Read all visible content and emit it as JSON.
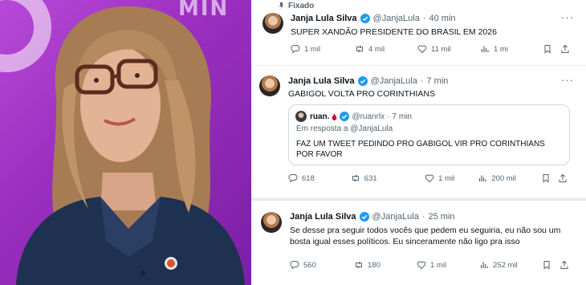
{
  "photo": {
    "background_text": "MIN",
    "accent": "#a63bcf"
  },
  "tweets": [
    {
      "pinned_label": "Fixado",
      "author": "Janja Lula Silva",
      "handle": "@JanjaLula",
      "separator": "·",
      "time": "40 min",
      "text": "SUPER XANDÃO PRESIDENTE DO BRASIL EM 2026",
      "replies": "1 mil",
      "retweets": "4 mil",
      "likes": "11 mil",
      "views": "1 mi"
    },
    {
      "author": "Janja Lula Silva",
      "handle": "@JanjaLula",
      "separator": "·",
      "time": "7 min",
      "text": "GABIGOL VOLTA PRO CORINTHIANS",
      "quote": {
        "author": "ruan.",
        "handle": "@ruanrlx",
        "separator": "·",
        "time": "7 min",
        "reply_prefix": "Em resposta a",
        "reply_mention": "@JanjaLula",
        "text": "FAZ UM TWEET PEDINDO PRO GABIGOL VIR PRO CORINTHIANS POR FAVOR"
      },
      "replies": "618",
      "retweets": "631",
      "likes": "1 mil",
      "views": "200 mil"
    },
    {
      "author": "Janja Lula Silva",
      "handle": "@JanjaLula",
      "separator": "·",
      "time": "25 min",
      "text": "Se desse pra seguir todos vocês que pedem eu seguiria, eu não sou um bosta igual esses políticos. Eu sinceramente não ligo pra isso",
      "replies": "560",
      "retweets": "180",
      "likes": "1 mil",
      "views": "252 mil"
    }
  ],
  "colors": {
    "verified": "#1d9bf0",
    "muted": "#536471",
    "border": "#cfd9de",
    "text": "#0f1419"
  }
}
